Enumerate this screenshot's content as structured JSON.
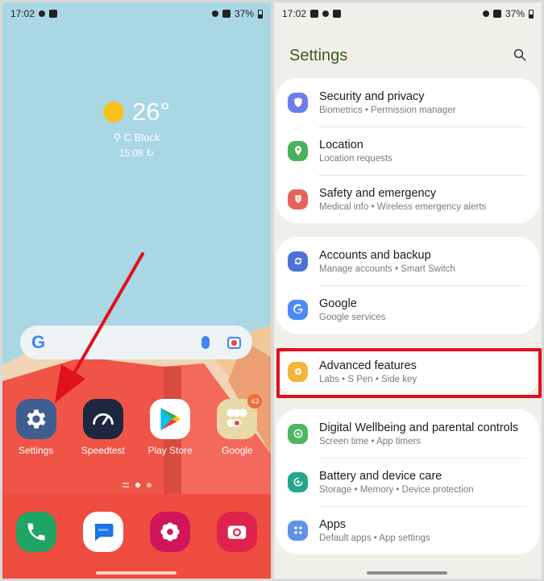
{
  "left": {
    "status": {
      "time": "17:02",
      "battery": "37%"
    },
    "weather": {
      "temperature": "26°",
      "location": "C Block",
      "time": "15:08"
    },
    "search_bar": {
      "logo": "G"
    },
    "apps": [
      {
        "label": "Settings",
        "icon": "gear-icon",
        "color": "#3f5e90"
      },
      {
        "label": "Speedtest",
        "icon": "gauge-icon",
        "color": "#1d2740"
      },
      {
        "label": "Play Store",
        "icon": "play-icon",
        "color": "#ffffff"
      },
      {
        "label": "Google",
        "icon": "folder-icon",
        "color": "#e7d9a8",
        "badge": "43"
      }
    ],
    "dock": [
      {
        "icon": "phone-icon",
        "color": "#1fa463"
      },
      {
        "icon": "messages-icon",
        "color": "#ffffff"
      },
      {
        "icon": "flower-icon",
        "color": "#d1155b"
      },
      {
        "icon": "camera-icon",
        "color": "#e0234e"
      }
    ]
  },
  "right": {
    "status": {
      "time": "17:02",
      "battery": "37%"
    },
    "title": "Settings",
    "groups": [
      {
        "items": [
          {
            "title": "Security and privacy",
            "subtitle": "Biometrics  •  Permission manager",
            "icon": "shield-icon",
            "color": "#6c7ee8"
          },
          {
            "title": "Location",
            "subtitle": "Location requests",
            "icon": "location-pin-icon",
            "color": "#48b35a"
          },
          {
            "title": "Safety and emergency",
            "subtitle": "Medical info  •  Wireless emergency alerts",
            "icon": "alert-icon",
            "color": "#e5635c"
          }
        ]
      },
      {
        "items": [
          {
            "title": "Accounts and backup",
            "subtitle": "Manage accounts  •  Smart Switch",
            "icon": "sync-icon",
            "color": "#4d72d6"
          },
          {
            "title": "Google",
            "subtitle": "Google services",
            "icon": "google-icon",
            "color": "#4a8af4"
          }
        ]
      },
      {
        "items": [
          {
            "title": "Advanced features",
            "subtitle": "Labs  •  S Pen  •  Side key",
            "icon": "plus-gear-icon",
            "color": "#f3b63d"
          }
        ]
      },
      {
        "items": [
          {
            "title": "Digital Wellbeing and parental controls",
            "subtitle": "Screen time  •  App timers",
            "icon": "wellbeing-icon",
            "color": "#4cb662"
          },
          {
            "title": "Battery and device care",
            "subtitle": "Storage  •  Memory  •  Device protection",
            "icon": "device-care-icon",
            "color": "#25a68d"
          },
          {
            "title": "Apps",
            "subtitle": "Default apps  •  App settings",
            "icon": "apps-grid-icon",
            "color": "#5f93e8"
          }
        ]
      }
    ]
  }
}
